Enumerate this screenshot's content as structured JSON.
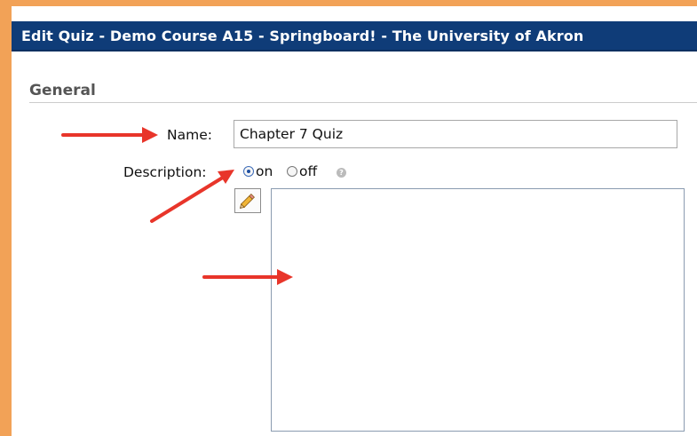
{
  "dialog": {
    "title": "Edit Quiz - Demo Course A15 - Springboard! - The University of Akron"
  },
  "section": {
    "header": "General"
  },
  "form": {
    "name_label": "Name:",
    "name_value": "Chapter 7 Quiz",
    "description_label": "Description:",
    "description_options": [
      {
        "label": "on",
        "selected": true
      },
      {
        "label": "off",
        "selected": false
      }
    ],
    "help_icon": "?",
    "editor_icon": "pencil-icon",
    "description_value": ""
  },
  "colors": {
    "frame": "#f2a257",
    "title_bar": "#0f3c78",
    "annotation_arrow": "#e8352a"
  }
}
